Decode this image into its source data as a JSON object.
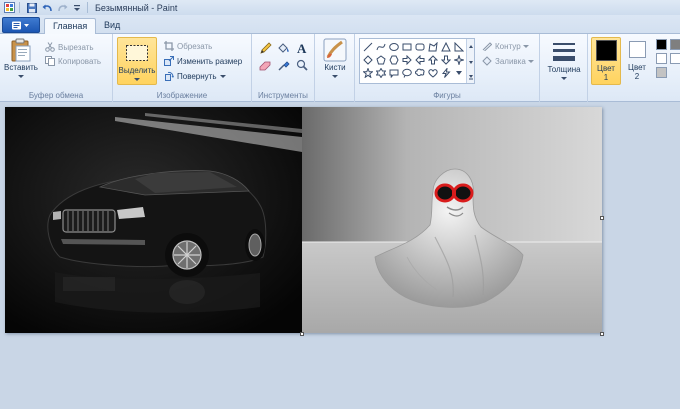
{
  "window": {
    "title": "Безымянный - Paint"
  },
  "tabs": {
    "home": "Главная",
    "view": "Вид"
  },
  "clipboard": {
    "paste_label": "Вставить",
    "cut_label": "Вырезать",
    "copy_label": "Копировать",
    "group_label": "Буфер обмена"
  },
  "image": {
    "select_label": "Выделить",
    "crop_label": "Обрезать",
    "resize_label": "Изменить размер",
    "rotate_label": "Повернуть",
    "group_label": "Изображение"
  },
  "tools": {
    "group_label": "Инструменты",
    "brushes_label": "Кисти"
  },
  "shapes": {
    "outline_label": "Контур",
    "fill_label": "Заливка",
    "group_label": "Фигуры"
  },
  "size": {
    "thickness_label": "Толщина"
  },
  "colors": {
    "color1_label": "Цвет",
    "color1_num": "1",
    "color2_label": "Цвет",
    "color2_num": "2",
    "color1_value": "#000000",
    "color2_value": "#ffffff",
    "palette": [
      "#000000",
      "#ffffff",
      "#c3c3c3",
      "#ffffff"
    ]
  }
}
